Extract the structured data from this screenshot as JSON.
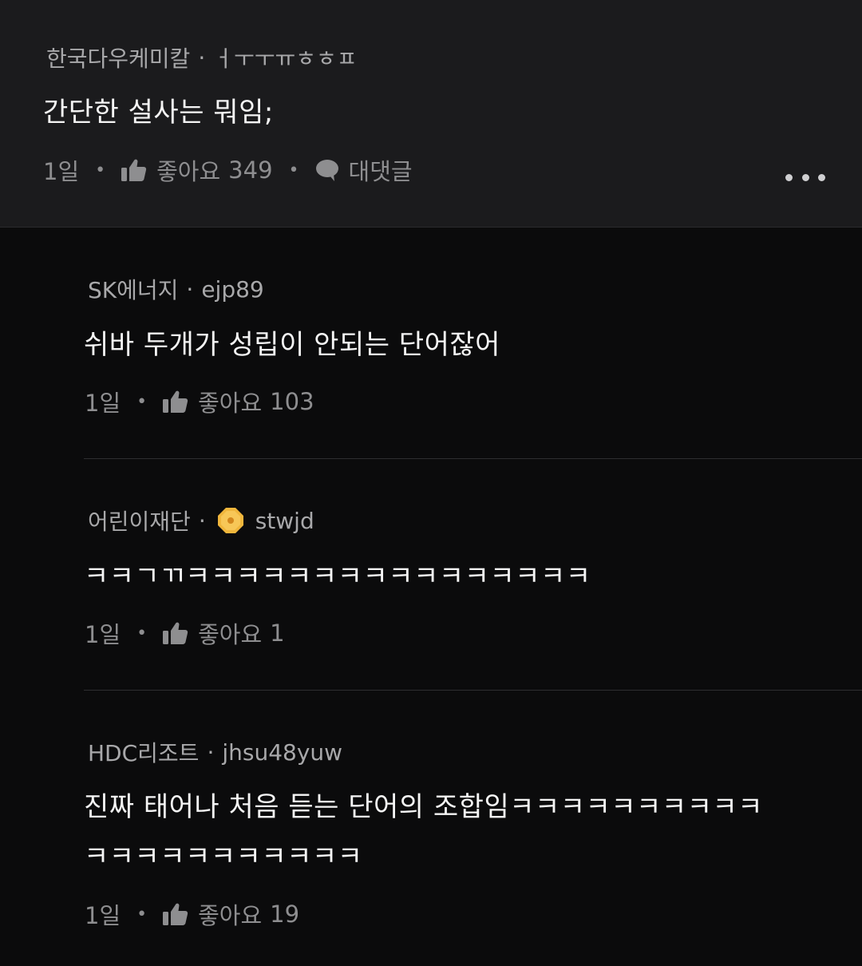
{
  "parent_comment": {
    "company": "한국다우케미칼",
    "nickname": "ㅓㅜㅜㅠㅎㅎㅍ",
    "text": "간단한 설사는 뭐임;",
    "time": "1일",
    "like_label": "좋아요",
    "like_count": "349",
    "reply_label": "대댓글"
  },
  "replies": [
    {
      "company": "SK에너지",
      "nickname": "ejp89",
      "text_lines": [
        "쉬바 두개가 성립이 안되는 단어잖어"
      ],
      "time": "1일",
      "like_label": "좋아요",
      "like_count": "103"
    },
    {
      "company": "어린이재단",
      "nickname": "stwjd",
      "badge_icon": "gold-octagon-badge-icon",
      "text_lines": [
        "ㅋㅋㄱㄲㅋㅋㅋㅋㅋㅋㅋㅋㅋㅋㅋㅋㅋㅋㅋㅋ"
      ],
      "time": "1일",
      "like_label": "좋아요",
      "like_count": "1"
    },
    {
      "company": "HDC리조트",
      "nickname": "jhsu48yuw",
      "text_lines": [
        "진짜 태어나 처음 듣는 단어의 조합임ㅋㅋㅋㅋㅋㅋㅋㅋㅋㅋ",
        "ㅋㅋㅋㅋㅋㅋㅋㅋㅋㅋㅋ"
      ],
      "time": "1일",
      "like_label": "좋아요",
      "like_count": "19"
    }
  ],
  "colors": {
    "background": "#0b0b0c",
    "parent_background": "#1b1b1d",
    "meta_text": "#8e8e90",
    "author_text": "#a8a8aa",
    "badge": "#f0b63c"
  }
}
